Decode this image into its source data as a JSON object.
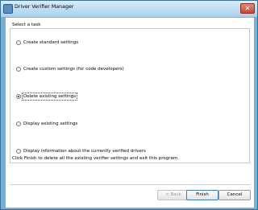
{
  "window": {
    "title": "Driver Verifier Manager",
    "close_symbol": "✕"
  },
  "task": {
    "group_label": "Select a task",
    "options": [
      {
        "label": "Create standard settings",
        "checked": false
      },
      {
        "label": "Create custom settings (for code developers)",
        "checked": false
      },
      {
        "label": "Delete existing settings",
        "checked": true
      },
      {
        "label": "Display existing settings",
        "checked": false
      },
      {
        "label": "Display information about the currently verified drivers",
        "checked": false
      }
    ]
  },
  "hint": "Click Finish to delete all the existing verifier settings and exit this program.",
  "buttons": {
    "back": "< Back",
    "finish": "Finish",
    "cancel": "Cancel"
  }
}
